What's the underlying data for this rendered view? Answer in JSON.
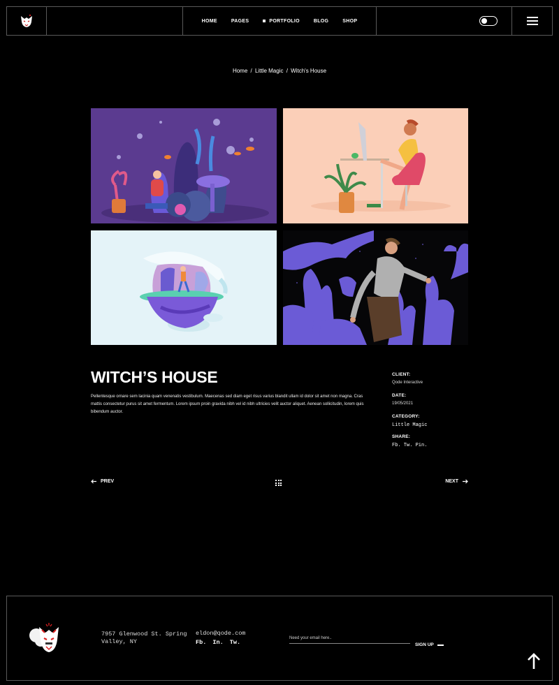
{
  "nav": {
    "items": [
      {
        "label": "HOME"
      },
      {
        "label": "PAGES"
      },
      {
        "label": "PORTFOLIO"
      },
      {
        "label": "BLOG"
      },
      {
        "label": "SHOP"
      }
    ]
  },
  "breadcrumb": {
    "home": "Home",
    "sep1": "/",
    "category": "Little Magic",
    "sep2": "/",
    "current": "Witch's House"
  },
  "project": {
    "title": "WITCH’S HOUSE",
    "description": "Pellentesque ornare sem lacinia quam venenatis vestibulum. Maecenas sed diam eget risus varius blandit ullam id dolor sit amet non magna. Cras mattis consectetur purus sit amet fermentum. Lorem ipsum proin gravida nibh vel id nibh ultricies velit auctor aliquet. Aenean sollicitudin, lorem quis bibendum auctor.",
    "client_label": "CLIENT:",
    "client": "Qode Interactive",
    "date_label": "DATE:",
    "date": "19/05/2021",
    "category_label": "CATEGORY:",
    "category": "Little Magic",
    "share_label": "SHARE:",
    "share": "Fb. Tw. Pin."
  },
  "pager": {
    "prev": "PREV",
    "next": "NEXT"
  },
  "footer": {
    "address": "7957 Glenwood St. Spring Valley, NY",
    "email": "eldon@qode.com",
    "social": "Fb. In. Tw.",
    "email_placeholder": "Need your email here..",
    "signup": "SIGN UP"
  },
  "colors": {
    "background": "#000000",
    "border": "#5a5a5a",
    "accent_purple": "#6b5bd6"
  },
  "icons": [
    "logo-icon",
    "toggle-switch",
    "hamburger-icon",
    "arrow-left-icon",
    "grid-icon",
    "arrow-right-icon",
    "arrow-up-icon"
  ]
}
